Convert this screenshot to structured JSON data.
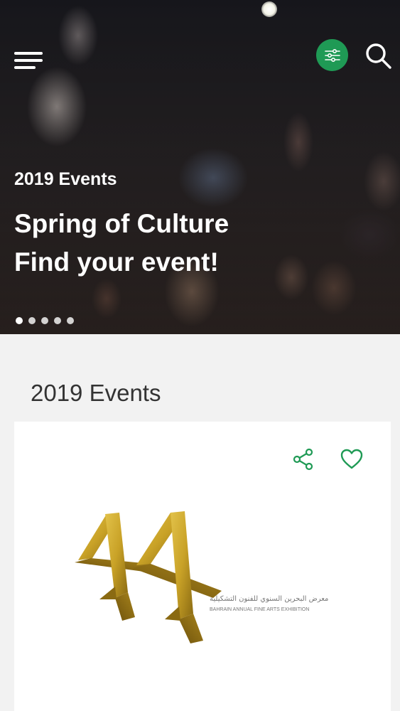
{
  "hero": {
    "subtitle": "2019 Events",
    "title_line1": "Spring of Culture",
    "title_line2": "Find your event!",
    "slide_count": 5,
    "active_slide": 1
  },
  "toolbar": {
    "menu_icon": "hamburger-menu-icon",
    "filter_icon": "sliders-icon",
    "search_icon": "search-icon"
  },
  "section": {
    "title": "2019 Events"
  },
  "event_card": {
    "logo_text": "44",
    "logo_caption_ar": "معرض البحرين السنوي للفنون التشكيلية",
    "logo_caption_en": "BAHRAIN ANNUAL FINE ARTS EXHIBITION",
    "share_icon": "share-icon",
    "favorite_icon": "heart-icon"
  },
  "colors": {
    "accent": "#1f9a55",
    "logo_gold": "#c9a227",
    "background": "#f2f2f2"
  }
}
